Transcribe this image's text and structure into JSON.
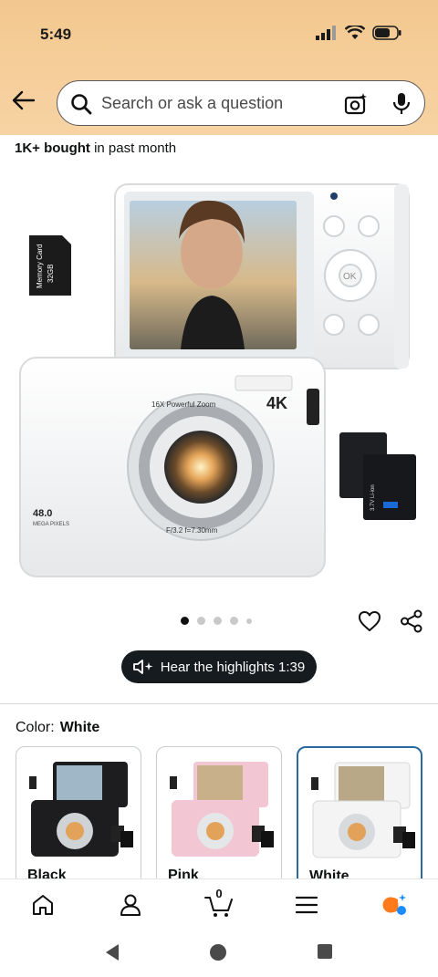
{
  "status": {
    "time": "5:49"
  },
  "search": {
    "placeholder": "Search or ask a question"
  },
  "social_proof": {
    "count": "1K+ bought",
    "suffix": " in past month"
  },
  "product_image": {
    "memory_card_text": "Memory Card",
    "memory_card_size": "32GB",
    "lens_text_top": "16X  Powerful  Zoom",
    "lens_text_bottom": "F/3.2  f=7.30mm",
    "resolution_badge": "4K",
    "megapixels": "48.0",
    "megapixels_label": "MEGA PIXELS",
    "battery_text": "3.7V  Li-ion"
  },
  "carousel": {
    "total": 5,
    "active": 0
  },
  "highlights": {
    "label": "Hear the highlights 1:39"
  },
  "color": {
    "label": "Color:",
    "value": "White"
  },
  "swatches": [
    {
      "label": "Black",
      "body": "#1d1d1f",
      "selected": false
    },
    {
      "label": "Pink",
      "body": "#f2c6d2",
      "selected": false
    },
    {
      "label": "White",
      "body": "#f4f4f4",
      "selected": true
    }
  ],
  "bottom_nav": {
    "cart_count": "0"
  },
  "colors": {
    "header_bg": "#f3c88f",
    "selected_border": "#2a6a9e",
    "accent_orange": "#ff7a1a",
    "accent_blue": "#1a8cff"
  }
}
